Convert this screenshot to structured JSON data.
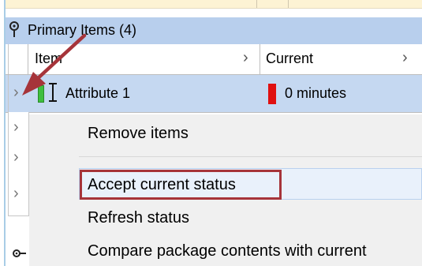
{
  "group": {
    "title": "Primary Items (4)"
  },
  "columns": {
    "item_label": "Item",
    "current_label": "Current",
    "sort_glyph": "›"
  },
  "row": {
    "expander": "›",
    "label": "Attribute 1",
    "value": "0 minutes",
    "status_color": "#e01010",
    "indicator_color": "#3fbf3f"
  },
  "gutter": {
    "expander": "›"
  },
  "context_menu": {
    "items": [
      {
        "label": "Remove items"
      },
      {
        "label": "Accept current status"
      },
      {
        "label": "Refresh status"
      },
      {
        "label": "Compare package contents with current"
      }
    ],
    "highlighted_index": 1
  },
  "colors": {
    "group_header": "#b8cfed",
    "selected_row": "#c5d8f1",
    "annotation": "#a6343a"
  },
  "icons": [
    "pin-icon",
    "ibeam-icon",
    "annotation-arrow",
    "collapse-icon"
  ]
}
